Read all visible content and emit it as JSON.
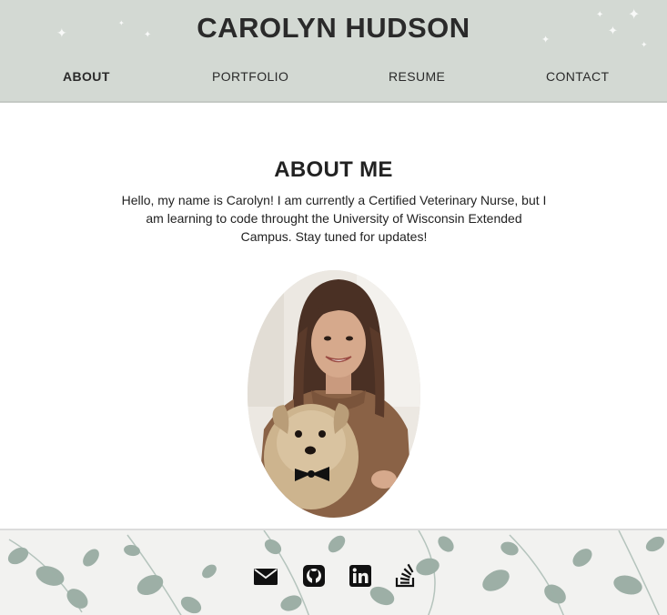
{
  "header": {
    "title": "CAROLYN HUDSON",
    "nav": [
      {
        "label": "ABOUT",
        "active": true
      },
      {
        "label": "PORTFOLIO",
        "active": false
      },
      {
        "label": "RESUME",
        "active": false
      },
      {
        "label": "CONTACT",
        "active": false
      }
    ]
  },
  "about": {
    "heading": "ABOUT ME",
    "body": "Hello, my name is Carolyn! I am currently a Certified Veterinary Nurse, but I am learning to code throught the University of Wisconsin Extended Campus. Stay tuned for updates!",
    "photo_icon": "portrait-with-dog"
  },
  "footer": {
    "social_icons": [
      "email-icon",
      "github-icon",
      "linkedin-icon",
      "stackoverflow-icon"
    ]
  },
  "colors": {
    "header_bg": "#d3d9d3",
    "text": "#222222",
    "footer_bg": "#f2f2f0",
    "leaf": "#8fa49a"
  }
}
